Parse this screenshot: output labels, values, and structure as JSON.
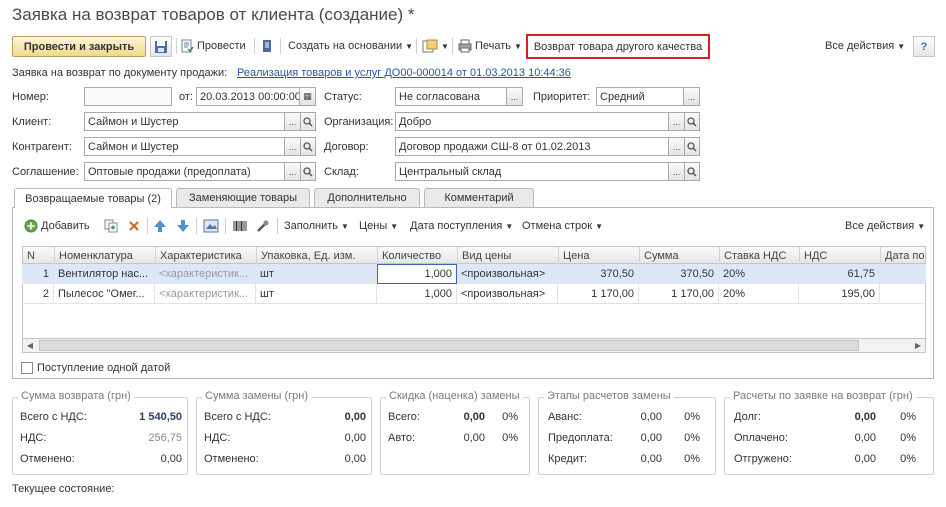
{
  "title": "Заявка на возврат товаров от клиента (создание) *",
  "toolbar": {
    "post_close": "Провести и закрыть",
    "post": "Провести",
    "create_based": "Создать на основании",
    "print": "Печать",
    "return_other_quality": "Возврат товара другого качества",
    "all_actions": "Все действия"
  },
  "form": {
    "sale_doc_label": "Заявка на возврат по документу продажи:",
    "sale_doc_link": "Реализация товаров и услуг ДО00-000014 от 01.03.2013 10:44:36",
    "number_label": "Номер:",
    "number_value": "",
    "date_label": "от:",
    "date_value": "20.03.2013 00:00:00",
    "status_label": "Статус:",
    "status_value": "Не согласована",
    "priority_label": "Приоритет:",
    "priority_value": "Средний",
    "client_label": "Клиент:",
    "client_value": "Саймон и Шустер",
    "org_label": "Организация:",
    "org_value": "Добро",
    "contractor_label": "Контрагент:",
    "contractor_value": "Саймон и Шустер",
    "contract_label": "Договор:",
    "contract_value": "Договор продажи СШ-8 от 01.02.2013",
    "agreement_label": "Соглашение:",
    "agreement_value": "Оптовые продажи (предоплата)",
    "warehouse_label": "Склад:",
    "warehouse_value": "Центральный склад"
  },
  "tabs": [
    {
      "label": "Возвращаемые товары (2)"
    },
    {
      "label": "Заменяющие товары"
    },
    {
      "label": "Дополнительно"
    },
    {
      "label": "Комментарий"
    }
  ],
  "table_toolbar": {
    "add": "Добавить",
    "fill": "Заполнить",
    "prices": "Цены",
    "arrival_date": "Дата поступления",
    "cancel_rows": "Отмена строк",
    "all_actions": "Все действия"
  },
  "columns": [
    "N",
    "Номенклатура",
    "Характеристика",
    "Упаковка, Ед. изм.",
    "Количество",
    "Вид цены",
    "Цена",
    "Сумма",
    "Ставка НДС",
    "НДС",
    "Дата по"
  ],
  "rows": [
    [
      "1",
      "Вентилятор нас...",
      "<характеристик...",
      "шт",
      "1,000",
      "<произвольная>",
      "370,50",
      "370,50",
      "20%",
      "61,75",
      ""
    ],
    [
      "2",
      "Пылесос \"Омег...",
      "<характеристик...",
      "шт",
      "1,000",
      "<произвольная>",
      "1 170,00",
      "1 170,00",
      "20%",
      "195,00",
      ""
    ]
  ],
  "one_date_label": "Поступление одной датой",
  "summary": {
    "return_sum": {
      "title": "Сумма возврата (грн)",
      "total_label": "Всего с НДС:",
      "total": "1 540,50",
      "vat_label": "НДС:",
      "vat": "256,75",
      "cancel_label": "Отменено:",
      "cancel": "0,00"
    },
    "replace_sum": {
      "title": "Сумма замены (грн)",
      "total_label": "Всего с НДС:",
      "total": "0,00",
      "vat_label": "НДС:",
      "vat": "0,00",
      "cancel_label": "Отменено:",
      "cancel": "0,00"
    },
    "discount": {
      "title": "Скидка (наценка) замены",
      "total_label": "Всего:",
      "total": "0,00",
      "total_pct": "0%",
      "auto_label": "Авто:",
      "auto": "0,00",
      "auto_pct": "0%"
    },
    "stages": {
      "title": "Этапы расчетов замены",
      "advance_label": "Аванс:",
      "advance": "0,00",
      "advance_pct": "0%",
      "prepay_label": "Предоплата:",
      "prepay": "0,00",
      "prepay_pct": "0%",
      "credit_label": "Кредит:",
      "credit": "0,00",
      "credit_pct": "0%"
    },
    "settlements": {
      "title": "Расчеты по заявке на возврат (грн)",
      "debt_label": "Долг:",
      "debt": "0,00",
      "debt_pct": "0%",
      "paid_label": "Оплачено:",
      "paid": "0,00",
      "paid_pct": "0%",
      "shipped_label": "Отгружено:",
      "shipped": "0,00",
      "shipped_pct": "0%"
    }
  },
  "current_state_label": "Текущее состояние:"
}
